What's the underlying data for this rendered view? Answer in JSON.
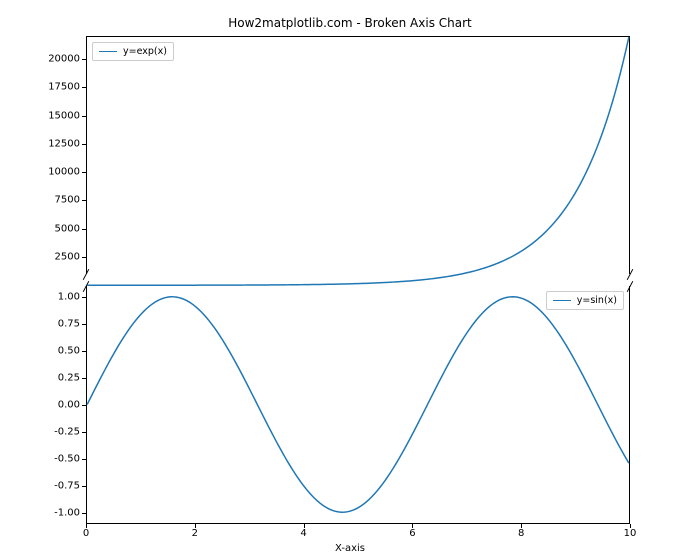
{
  "chart_data": [
    {
      "type": "line",
      "title": "How2matplotlib.com - Broken Axis Chart",
      "xlabel": "X-axis",
      "ylabel": "",
      "xlim": [
        0,
        10
      ],
      "ylim": [
        1000,
        22026
      ],
      "xticks": [
        0,
        2,
        4,
        6,
        8,
        10
      ],
      "yticks": [
        2500,
        5000,
        7500,
        10000,
        12500,
        15000,
        17500,
        20000
      ],
      "series": [
        {
          "name": "y=exp(x)",
          "x_range": [
            0,
            10
          ],
          "formula": "exp(x)"
        }
      ],
      "legend_pos": "upper-left"
    },
    {
      "type": "line",
      "title": "",
      "xlabel": "X-axis",
      "ylabel": "",
      "xlim": [
        0,
        10
      ],
      "ylim": [
        -1.1,
        1.1
      ],
      "xticks": [
        0,
        2,
        4,
        6,
        8,
        10
      ],
      "yticks": [
        -1.0,
        -0.75,
        -0.5,
        -0.25,
        0.0,
        0.25,
        0.5,
        0.75,
        1.0
      ],
      "series": [
        {
          "name": "y=sin(x)",
          "x_range": [
            0,
            10
          ],
          "formula": "sin(x)"
        }
      ],
      "legend_pos": "upper-right"
    }
  ],
  "colors": {
    "line": "#1f77b4"
  }
}
